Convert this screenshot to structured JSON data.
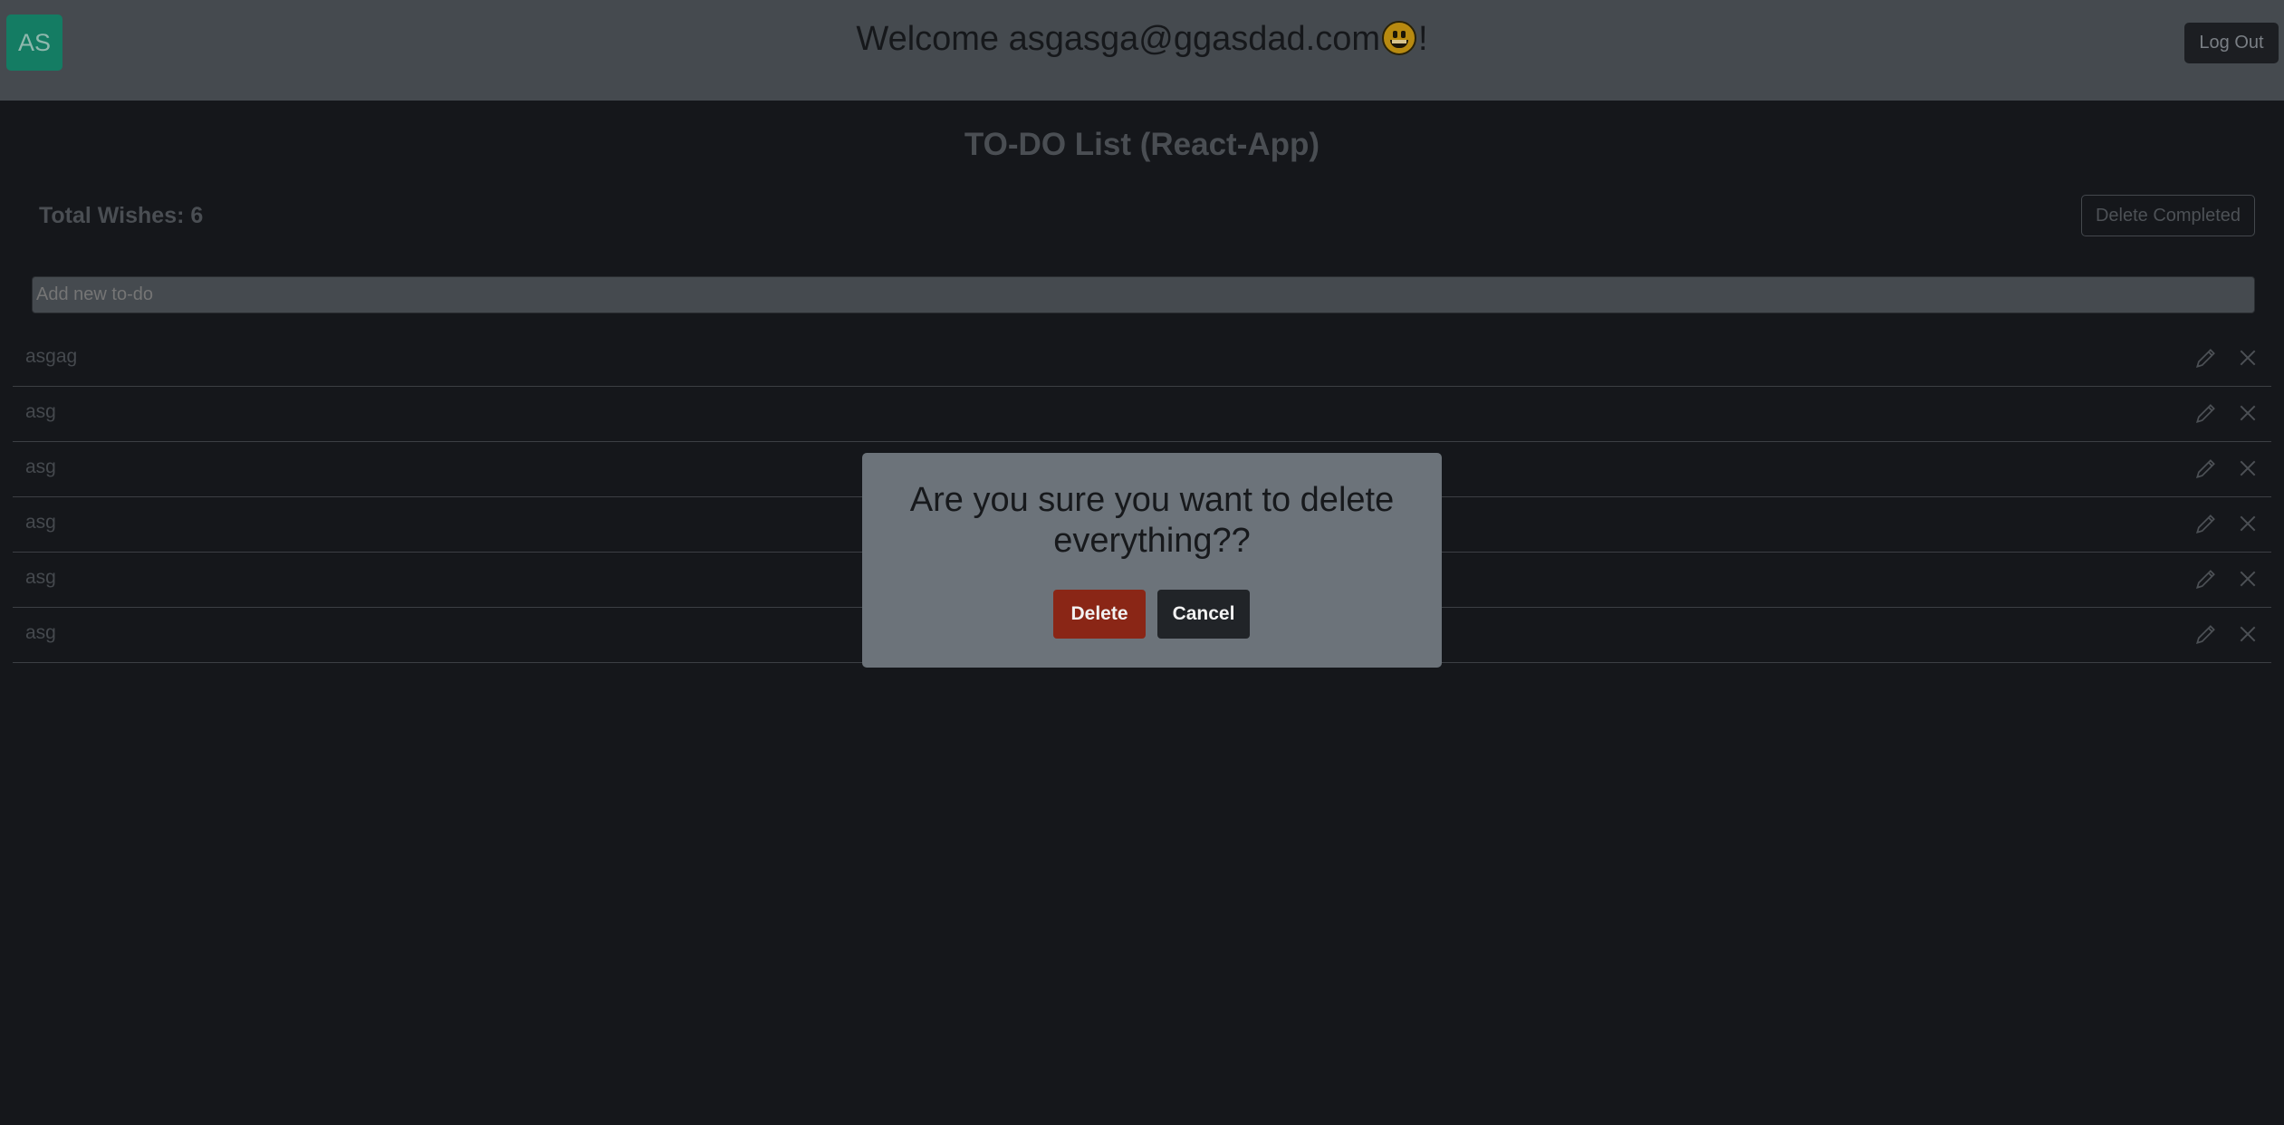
{
  "header": {
    "avatar_initials": "AS",
    "welcome_prefix": "Welcome asgasga@ggasdad.com",
    "welcome_suffix": "!",
    "emoji_icon": "grinning-face-emoji",
    "logout_label": "Log Out"
  },
  "main": {
    "title": "TO-DO List (React-App)",
    "total_label": "Total Wishes: 6",
    "delete_completed_label": "Delete Completed",
    "new_todo_placeholder": "Add new to-do",
    "todos": [
      {
        "text": "asgag"
      },
      {
        "text": "asg"
      },
      {
        "text": "asg"
      },
      {
        "text": "asg"
      },
      {
        "text": "asg"
      },
      {
        "text": "asg"
      }
    ],
    "item_icons": {
      "edit": "pencil-icon",
      "delete": "close-icon"
    }
  },
  "modal": {
    "message": "Are you sure you want to delete everything??",
    "delete_label": "Delete",
    "cancel_label": "Cancel"
  },
  "colors": {
    "header_bg": "#454a4f",
    "page_bg": "#15171b",
    "avatar_bg": "#147c63",
    "modal_bg": "#6c737a",
    "danger": "#8a2616",
    "dark_button": "#212428"
  }
}
